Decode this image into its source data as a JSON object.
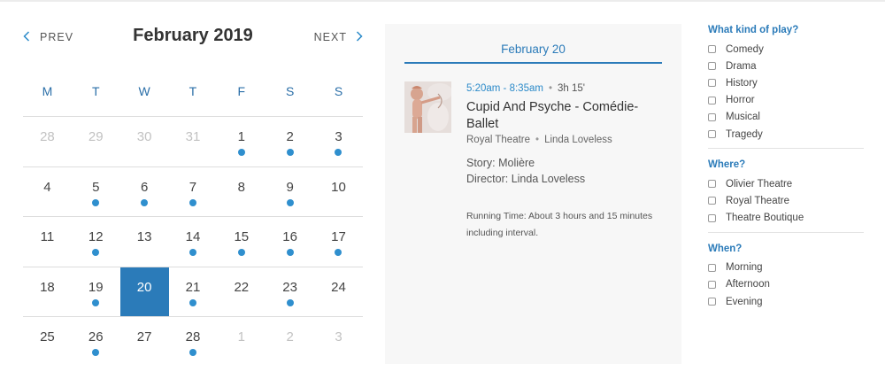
{
  "calendar": {
    "prev_label": "PREV",
    "next_label": "NEXT",
    "month_title": "February 2019",
    "weekdays": [
      "M",
      "T",
      "W",
      "T",
      "F",
      "S",
      "S"
    ],
    "weeks": [
      [
        {
          "d": "28",
          "muted": true,
          "dot": false
        },
        {
          "d": "29",
          "muted": true,
          "dot": false
        },
        {
          "d": "30",
          "muted": true,
          "dot": false
        },
        {
          "d": "31",
          "muted": true,
          "dot": false
        },
        {
          "d": "1",
          "muted": false,
          "dot": true
        },
        {
          "d": "2",
          "muted": false,
          "dot": true
        },
        {
          "d": "3",
          "muted": false,
          "dot": true
        }
      ],
      [
        {
          "d": "4",
          "muted": false,
          "dot": false
        },
        {
          "d": "5",
          "muted": false,
          "dot": true
        },
        {
          "d": "6",
          "muted": false,
          "dot": true
        },
        {
          "d": "7",
          "muted": false,
          "dot": true
        },
        {
          "d": "8",
          "muted": false,
          "dot": false
        },
        {
          "d": "9",
          "muted": false,
          "dot": true
        },
        {
          "d": "10",
          "muted": false,
          "dot": false
        }
      ],
      [
        {
          "d": "11",
          "muted": false,
          "dot": false
        },
        {
          "d": "12",
          "muted": false,
          "dot": true
        },
        {
          "d": "13",
          "muted": false,
          "dot": false
        },
        {
          "d": "14",
          "muted": false,
          "dot": true
        },
        {
          "d": "15",
          "muted": false,
          "dot": true
        },
        {
          "d": "16",
          "muted": false,
          "dot": true
        },
        {
          "d": "17",
          "muted": false,
          "dot": true
        }
      ],
      [
        {
          "d": "18",
          "muted": false,
          "dot": false
        },
        {
          "d": "19",
          "muted": false,
          "dot": true
        },
        {
          "d": "20",
          "muted": false,
          "dot": false,
          "selected": true
        },
        {
          "d": "21",
          "muted": false,
          "dot": true
        },
        {
          "d": "22",
          "muted": false,
          "dot": false
        },
        {
          "d": "23",
          "muted": false,
          "dot": true
        },
        {
          "d": "24",
          "muted": false,
          "dot": false
        }
      ],
      [
        {
          "d": "25",
          "muted": false,
          "dot": false
        },
        {
          "d": "26",
          "muted": false,
          "dot": true
        },
        {
          "d": "27",
          "muted": false,
          "dot": false
        },
        {
          "d": "28",
          "muted": false,
          "dot": true
        },
        {
          "d": "1",
          "muted": true,
          "dot": false
        },
        {
          "d": "2",
          "muted": true,
          "dot": false
        },
        {
          "d": "3",
          "muted": true,
          "dot": false
        }
      ]
    ]
  },
  "event_panel": {
    "date_heading": "February 20",
    "event": {
      "time": "5:20am - 8:35am",
      "duration": "3h 15'",
      "title": "Cupid And Psyche - Comédie-Ballet",
      "venue": "Royal Theatre",
      "person": "Linda Loveless",
      "story": "Story: Molière",
      "director": "Director: Linda Loveless",
      "running_time": "Running Time: About 3 hours and 15 minutes including interval."
    }
  },
  "filters": [
    {
      "heading": "What kind of play?",
      "options": [
        "Comedy",
        "Drama",
        "History",
        "Horror",
        "Musical",
        "Tragedy"
      ]
    },
    {
      "heading": "Where?",
      "options": [
        "Olivier Theatre",
        "Royal Theatre",
        "Theatre Boutique"
      ]
    },
    {
      "heading": "When?",
      "options": [
        "Morning",
        "Afternoon",
        "Evening"
      ]
    }
  ],
  "colors": {
    "accent": "#2b7bb9",
    "dot": "#2f8fce",
    "panel_bg": "#f7f7f7"
  }
}
